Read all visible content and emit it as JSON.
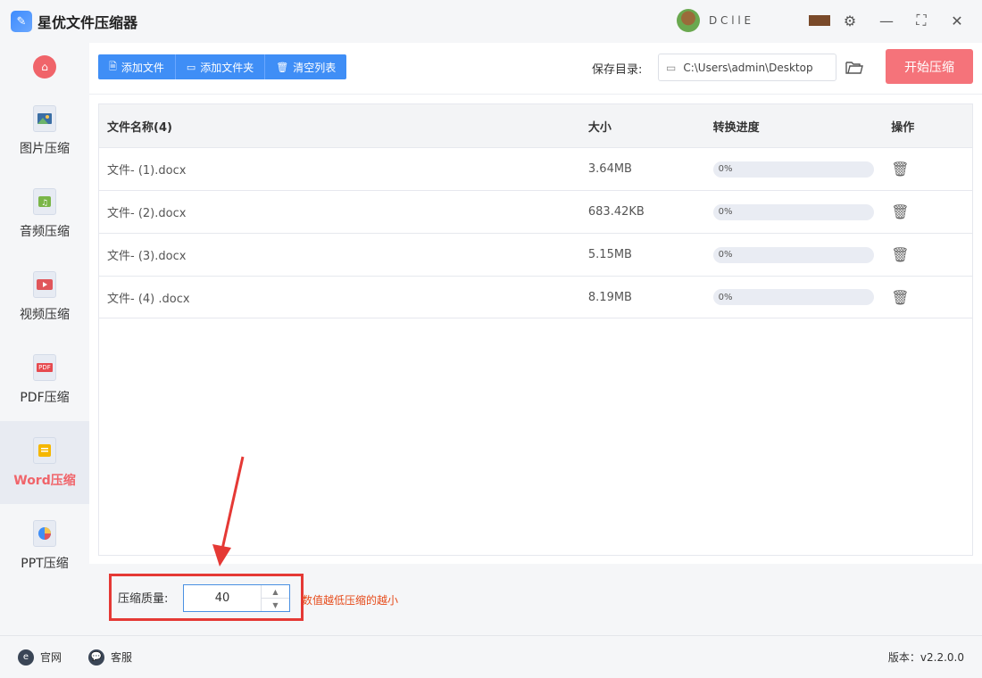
{
  "app": {
    "title": "星优文件压缩器",
    "user_name": "D  C  l  l  E"
  },
  "sidebar": {
    "items": [
      {
        "label": "图片压缩",
        "icon": "image-icon"
      },
      {
        "label": "音频压缩",
        "icon": "audio-icon"
      },
      {
        "label": "视频压缩",
        "icon": "video-icon"
      },
      {
        "label": "PDF压缩",
        "icon": "pdf-icon",
        "icon_text": "PDF"
      },
      {
        "label": "Word压缩",
        "icon": "word-icon",
        "active": true
      },
      {
        "label": "PPT压缩",
        "icon": "ppt-icon"
      }
    ]
  },
  "toolbar": {
    "add_file": "添加文件",
    "add_folder": "添加文件夹",
    "clear_list": "清空列表",
    "save_label": "保存目录:",
    "save_path": "C:\\Users\\admin\\Desktop",
    "start_button": "开始压缩"
  },
  "table": {
    "headers": {
      "name": "文件名称(4)",
      "size": "大小",
      "progress": "转换进度",
      "action": "操作"
    },
    "rows": [
      {
        "name": "文件- (1).docx",
        "size": "3.64MB",
        "progress": "0%"
      },
      {
        "name": "文件- (2).docx",
        "size": "683.42KB",
        "progress": "0%"
      },
      {
        "name": "文件- (3).docx",
        "size": "5.15MB",
        "progress": "0%"
      },
      {
        "name": "文件- (4) .docx",
        "size": "8.19MB",
        "progress": "0%"
      }
    ]
  },
  "quality": {
    "label": "压缩质量:",
    "value": "40",
    "hint": "数值越低压缩的越小"
  },
  "footer": {
    "website": "官网",
    "support": "客服",
    "version": "版本：v2.2.0.0"
  },
  "colors": {
    "accent": "#3f8ef6",
    "start": "#f5737a",
    "active": "#f0646a",
    "highlight": "#e53935"
  }
}
